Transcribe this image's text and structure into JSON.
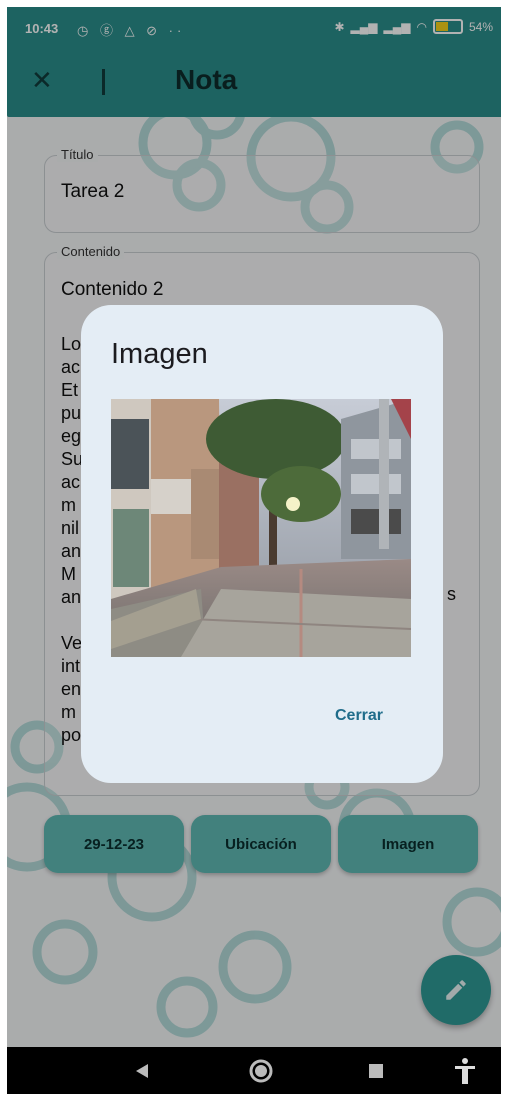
{
  "status_bar": {
    "time": "10:43",
    "battery_percent": "54%",
    "battery_level": 0.54
  },
  "app_bar": {
    "title": "Nota",
    "close_icon": "close-icon"
  },
  "form": {
    "title_legend": "Título",
    "title_value": "Tarea 2",
    "content_legend": "Contenido",
    "content_value": "Contenido 2",
    "partial_lines": [
      "Lo",
      "ac",
      "Et",
      "pu",
      "eg",
      "Su",
      "ac",
      "m",
      "nil",
      "an",
      "M",
      "an",
      "",
      "Ve",
      "int",
      "en",
      "m",
      "po"
    ],
    "partial_right": "s"
  },
  "buttons": {
    "date": "29-12-23",
    "location": "Ubicación",
    "image": "Imagen"
  },
  "fab": {
    "icon": "pencil-icon"
  },
  "dialog": {
    "title": "Imagen",
    "close_label": "Cerrar",
    "photo_icon": "photo-street-scene"
  },
  "navigation": {
    "back_icon": "back-triangle-icon",
    "home_icon": "home-circle-icon",
    "recents_icon": "recents-square-icon",
    "accessibility_icon": "accessibility-icon"
  },
  "colors": {
    "primary": "#2a8f8c",
    "button": "#5fb9b4",
    "dialog_bg": "#e4edf5",
    "accent_text": "#1f6c8a"
  }
}
